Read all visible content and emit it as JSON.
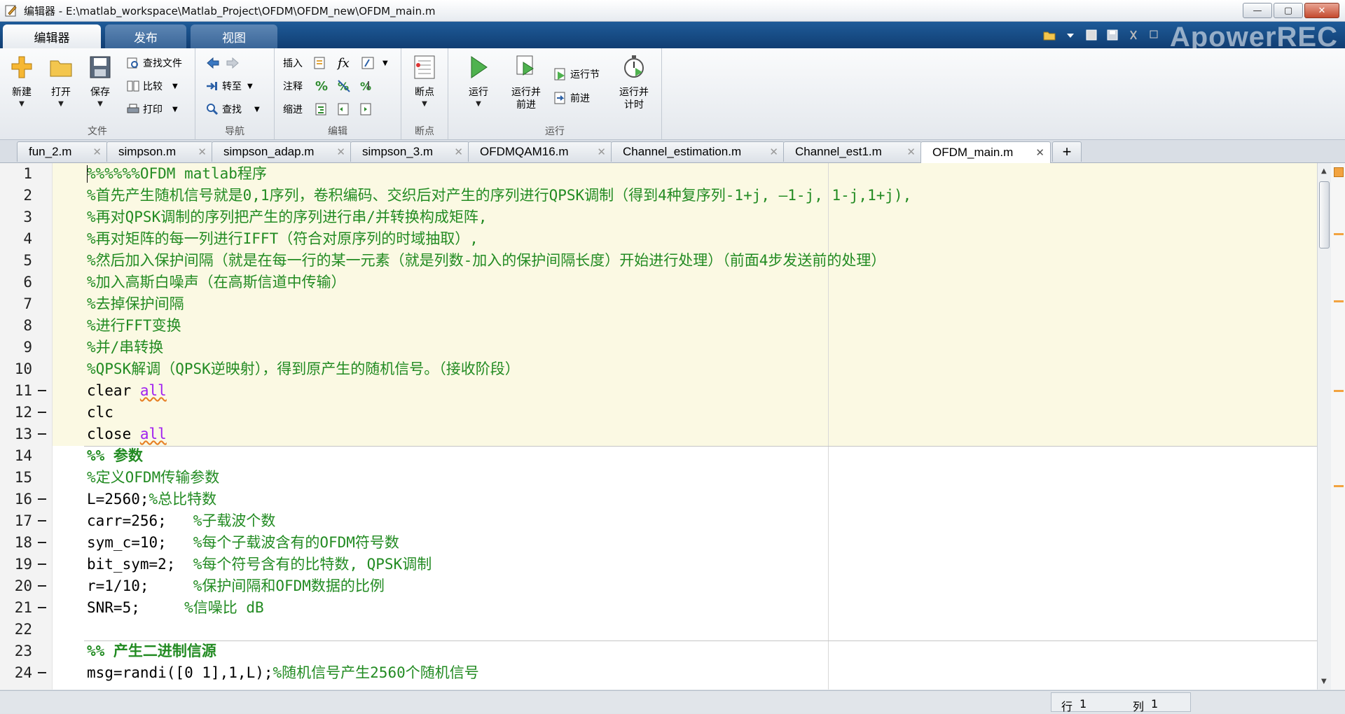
{
  "window": {
    "title": "编辑器 - E:\\matlab_workspace\\Matlab_Project\\OFDM\\OFDM_new\\OFDM_main.m",
    "controls": [
      "—",
      "▢",
      "✕"
    ]
  },
  "ribbon_tabs": [
    {
      "label": "编辑器",
      "active": true
    },
    {
      "label": "发布",
      "active": false
    },
    {
      "label": "视图",
      "active": false
    }
  ],
  "watermark": "ApowerREC",
  "ribbon": {
    "file_group": {
      "label": "文件",
      "new": "新建",
      "open": "打开",
      "save": "保存",
      "find_files": "查找文件",
      "compare": "比较",
      "print": "打印"
    },
    "nav_group": {
      "label": "导航",
      "goto": "转至",
      "find": "查找"
    },
    "edit_group": {
      "label": "编辑",
      "insert": "插入",
      "comment": "注释",
      "indent": "缩进",
      "fx": "fx",
      "percent": "%"
    },
    "breakpoint_group": {
      "label": "断点",
      "breakpoint": "断点"
    },
    "run_group": {
      "label": "运行",
      "run": "运行",
      "run_advance": "运行并\n前进",
      "run_section": "运行节",
      "advance": "前进",
      "run_time": "运行并\n计时"
    }
  },
  "file_tabs": [
    {
      "name": "fun_2.m",
      "active": false
    },
    {
      "name": "simpson.m",
      "active": false
    },
    {
      "name": "simpson_adap.m",
      "active": false
    },
    {
      "name": "simpson_3.m",
      "active": false
    },
    {
      "name": "OFDMQAM16.m",
      "active": false
    },
    {
      "name": "Channel_estimation.m",
      "active": false
    },
    {
      "name": "Channel_est1.m",
      "active": false
    },
    {
      "name": "OFDM_main.m",
      "active": true
    }
  ],
  "add_tab": "+",
  "code_lines": [
    {
      "n": "1",
      "dash": false,
      "parts": [
        {
          "t": "%%%%%%OFDM matlab程序",
          "c": "cm"
        }
      ]
    },
    {
      "n": "2",
      "dash": false,
      "parts": [
        {
          "t": "%首先产生随机信号就是0,1序列，卷积编码、交织后对产生的序列进行QPSK调制（得到4种复序列-1+j, —1-j, 1-j,1+j),",
          "c": "cm"
        }
      ]
    },
    {
      "n": "3",
      "dash": false,
      "parts": [
        {
          "t": "%再对QPSK调制的序列把产生的序列进行串/并转换构成矩阵,",
          "c": "cm"
        }
      ]
    },
    {
      "n": "4",
      "dash": false,
      "parts": [
        {
          "t": "%再对矩阵的每一列进行IFFT（符合对原序列的时域抽取）,",
          "c": "cm"
        }
      ]
    },
    {
      "n": "5",
      "dash": false,
      "parts": [
        {
          "t": "%然后加入保护间隔（就是在每一行的某一元素（就是列数-加入的保护间隔长度）开始进行处理）（前面4步发送前的处理）",
          "c": "cm"
        }
      ]
    },
    {
      "n": "6",
      "dash": false,
      "parts": [
        {
          "t": "%加入高斯白噪声（在高斯信道中传输）",
          "c": "cm"
        }
      ]
    },
    {
      "n": "7",
      "dash": false,
      "parts": [
        {
          "t": "%去掉保护间隔",
          "c": "cm"
        }
      ]
    },
    {
      "n": "8",
      "dash": false,
      "parts": [
        {
          "t": "%进行FFT变换",
          "c": "cm"
        }
      ]
    },
    {
      "n": "9",
      "dash": false,
      "parts": [
        {
          "t": "%并/串转换",
          "c": "cm"
        }
      ]
    },
    {
      "n": "10",
      "dash": false,
      "parts": [
        {
          "t": "%QPSK解调（QPSK逆映射），得到原产生的随机信号。（接收阶段）",
          "c": "cm"
        }
      ]
    },
    {
      "n": "11",
      "dash": true,
      "parts": [
        {
          "t": "clear ",
          "c": ""
        },
        {
          "t": "all",
          "c": "kw"
        }
      ]
    },
    {
      "n": "12",
      "dash": true,
      "parts": [
        {
          "t": "clc",
          "c": ""
        }
      ]
    },
    {
      "n": "13",
      "dash": true,
      "parts": [
        {
          "t": "close ",
          "c": ""
        },
        {
          "t": "all",
          "c": "kw"
        }
      ]
    },
    {
      "n": "14",
      "dash": false,
      "parts": [
        {
          "t": "%% 参数",
          "c": "sec"
        }
      ]
    },
    {
      "n": "15",
      "dash": false,
      "parts": [
        {
          "t": "%定义OFDM传输参数",
          "c": "cm"
        }
      ]
    },
    {
      "n": "16",
      "dash": true,
      "parts": [
        {
          "t": "L=2560;",
          "c": ""
        },
        {
          "t": "%总比特数",
          "c": "cm"
        }
      ]
    },
    {
      "n": "17",
      "dash": true,
      "parts": [
        {
          "t": "carr=256;   ",
          "c": ""
        },
        {
          "t": "%子载波个数",
          "c": "cm"
        }
      ]
    },
    {
      "n": "18",
      "dash": true,
      "parts": [
        {
          "t": "sym_c=10;   ",
          "c": ""
        },
        {
          "t": "%每个子载波含有的OFDM符号数",
          "c": "cm"
        }
      ]
    },
    {
      "n": "19",
      "dash": true,
      "parts": [
        {
          "t": "bit_sym=2;  ",
          "c": ""
        },
        {
          "t": "%每个符号含有的比特数, QPSK调制",
          "c": "cm"
        }
      ]
    },
    {
      "n": "20",
      "dash": true,
      "parts": [
        {
          "t": "r=1/10;     ",
          "c": ""
        },
        {
          "t": "%保护间隔和OFDM数据的比例",
          "c": "cm"
        }
      ]
    },
    {
      "n": "21",
      "dash": true,
      "parts": [
        {
          "t": "SNR=5;     ",
          "c": ""
        },
        {
          "t": "%信噪比 dB",
          "c": "cm"
        }
      ]
    },
    {
      "n": "22",
      "dash": false,
      "parts": []
    },
    {
      "n": "23",
      "dash": false,
      "parts": [
        {
          "t": "%% 产生二进制信源",
          "c": "sec"
        }
      ]
    },
    {
      "n": "24",
      "dash": true,
      "parts": [
        {
          "t": "msg=randi([0 1],1,L);",
          "c": ""
        },
        {
          "t": "%随机信号产生2560个随机信号",
          "c": "cm"
        }
      ]
    }
  ],
  "status": {
    "row_label": "行",
    "row_value": "1",
    "col_label": "列",
    "col_value": "1"
  },
  "colors": {
    "ribbon_header": "#113e73",
    "cell_highlight": "#fbf9e3",
    "comment": "#228b22",
    "keyword": "#a020f0",
    "marker": "#f2a340"
  }
}
